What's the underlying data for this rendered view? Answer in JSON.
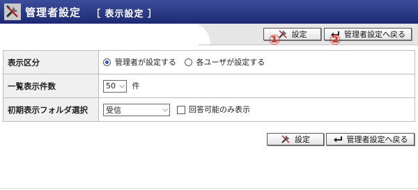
{
  "header": {
    "title": "管理者設定",
    "subtitle": "［ 表示設定 ］",
    "icon": "tools-icon"
  },
  "toolbar_top": {
    "save_label": "設定",
    "back_label": "管理者設定へ戻る",
    "marker1": "①",
    "marker2": "②"
  },
  "form": {
    "rows": [
      {
        "label": "表示区分",
        "options": [
          "管理者が設定する",
          "各ユーザが設定する"
        ],
        "selected": 0
      },
      {
        "label": "一覧表示件数",
        "value": "50",
        "unit": "件"
      },
      {
        "label": "初期表示フォルダ選択",
        "value": "受信",
        "checkbox_label": "回答可能のみ表示",
        "checked": false
      }
    ]
  },
  "toolbar_bottom": {
    "save_label": "設定",
    "back_label": "管理者設定へ戻る"
  },
  "colors": {
    "header_bg": "#1d2a72",
    "marker": "#e0362a",
    "radio_selected": "#1a55c8"
  }
}
